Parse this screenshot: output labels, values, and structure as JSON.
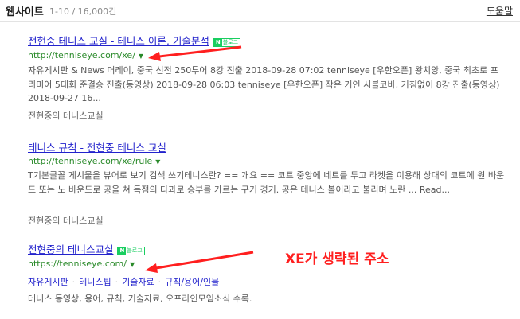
{
  "header": {
    "section_title": "웹사이트",
    "result_count": "1-10 / 16,000건",
    "help_link": "도움말"
  },
  "results": [
    {
      "title": "전현중 테니스 교실 - 테니스 이론, 기술분석",
      "badge": "블로그",
      "url": "http://tenniseye.com/xe/",
      "description": "자유게시판 & News 머레이, 중국 선전 250투어 8강 진출 2018-09-28 07:02 tenniseye [우한오픈] 왕치앙, 중국 최초로 프리미어 5대회 준결승 진출(동영상) 2018-09-28 06:03 tenniseye [우한오픈] 작은 거인 시블코바, 거침없이 8강 진출(동영상) 2018-09-27 16...",
      "site_name": "전현중의 테니스교실"
    },
    {
      "title": "테니스 규칙 - 전현중 테니스 교실",
      "url": "http://tenniseye.com/xe/rule",
      "description": "T기본글꼴 게시물을 뷰어로 보기 검색 쓰기테니스란? == 개요 == 코트 중앙에 네트를 두고 라켓을 이용해 상대의 코트에 원 바운드 또는 노 바운드로 공을 쳐 득점의 다과로 승부를 가르는 구기 경기. 공은 테니스 볼이라고 불리며 노란 ... Read...",
      "site_name": "전현중의 테니스교실"
    },
    {
      "title": "전현중의 테니스교실",
      "badge": "블로그",
      "url": "https://tenniseye.com/",
      "sublinks": [
        "자유게시판",
        "테니스팁",
        "기술자료",
        "규칙/용어/인물"
      ],
      "description": "테니스 동영상, 용어, 규칙, 기술자료, 오프라인모임소식 수록."
    }
  ],
  "annotation": {
    "text": "XE가 생략된 주소",
    "color": "#ff1f1f"
  },
  "colors": {
    "link": "#2222cc",
    "url": "#2a8a2a",
    "badge": "#19ce60",
    "arrow": "#ff1f1f"
  },
  "icons": {
    "dropdown": "triangle-down-icon",
    "arrow": "red-arrow-icon"
  }
}
